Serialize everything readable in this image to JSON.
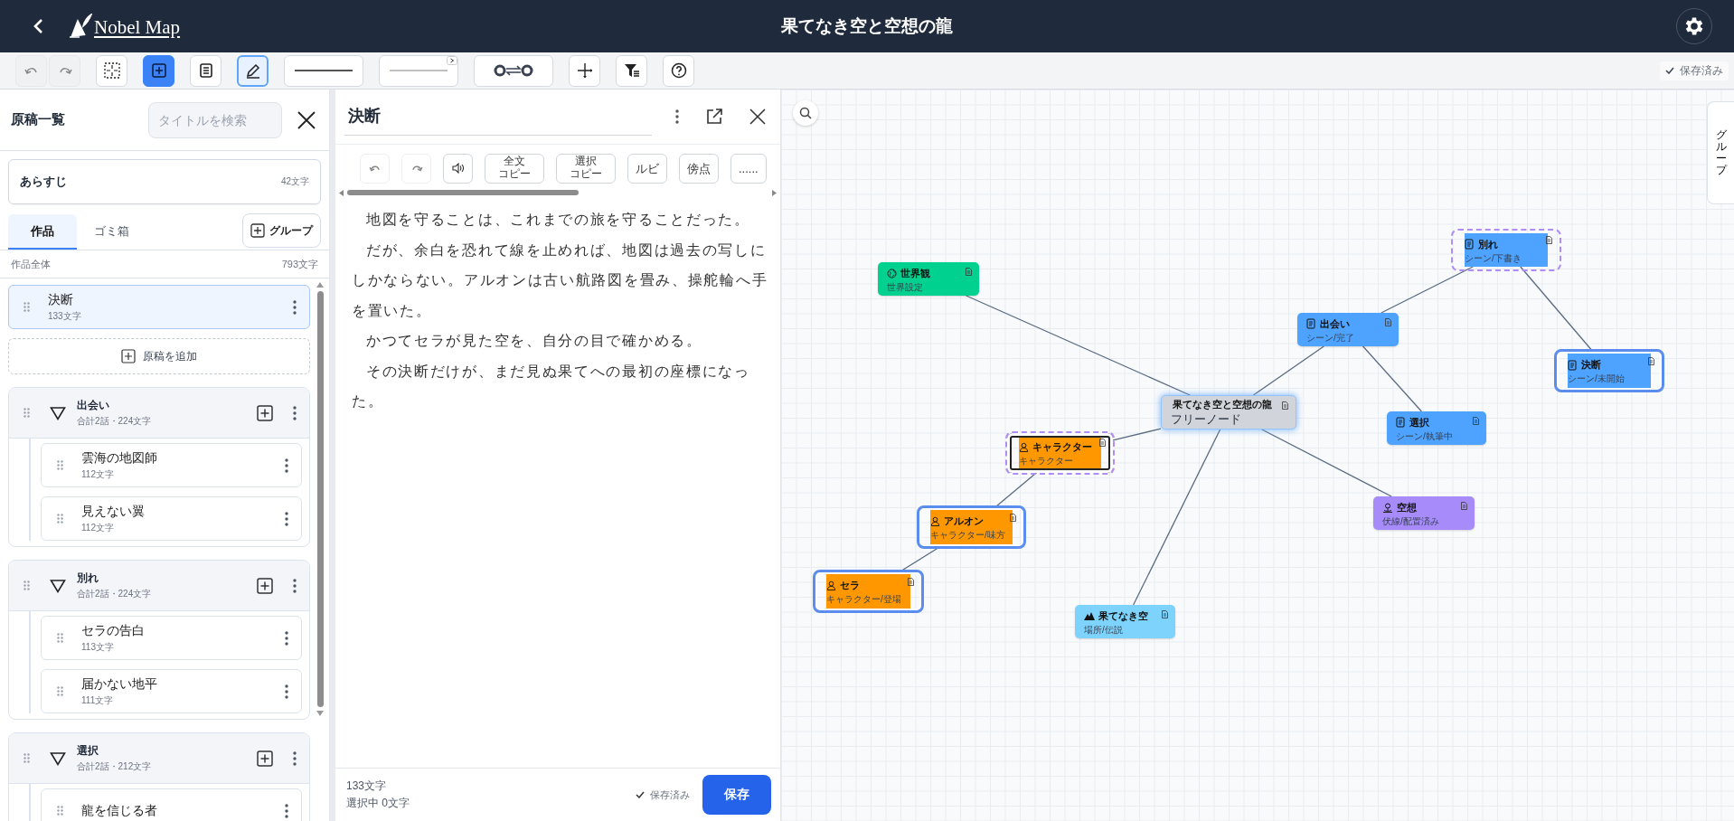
{
  "header": {
    "logo": "Nobel Map",
    "title": "果てなき空と空想の龍"
  },
  "toolbar": {
    "tools": [
      {
        "kind": "undo",
        "disabled": true,
        "selected": false,
        "active": false
      },
      {
        "kind": "redo",
        "disabled": true,
        "selected": false,
        "active": false
      },
      {
        "kind": "fit",
        "disabled": false,
        "selected": false,
        "active": false
      },
      {
        "kind": "add-node",
        "disabled": false,
        "selected": true,
        "active": false
      },
      {
        "kind": "note",
        "disabled": false,
        "selected": false,
        "active": false
      },
      {
        "kind": "pencil",
        "disabled": false,
        "selected": false,
        "active": true
      },
      {
        "kind": "line-solid",
        "disabled": false,
        "selected": false,
        "active": false
      },
      {
        "kind": "line-thin",
        "disabled": false,
        "selected": false,
        "active": false
      },
      {
        "kind": "link",
        "disabled": false,
        "selected": false,
        "active": false
      },
      {
        "kind": "move",
        "disabled": false,
        "selected": false,
        "active": false
      },
      {
        "kind": "filter",
        "disabled": false,
        "selected": false,
        "active": false
      },
      {
        "kind": "help",
        "disabled": false,
        "selected": false,
        "active": false
      }
    ],
    "save_status": "保存済み"
  },
  "manuscripts": {
    "title": "原稿一覧",
    "search": {
      "placeholder": "タイトルを検索"
    },
    "synopsis": {
      "label": "あらすじ",
      "count": "42文字"
    },
    "tabs": [
      {
        "label": "作品",
        "selected": true
      },
      {
        "label": "ゴミ箱",
        "selected": false
      }
    ],
    "group_button": "グループ",
    "summary": {
      "label": "作品全体",
      "count": "793文字"
    },
    "items": [
      {
        "kind": "doc",
        "title": "決断",
        "count": "133文字",
        "selected": true
      },
      {
        "kind": "add",
        "label": "原稿を追加"
      },
      {
        "kind": "group",
        "title": "出会い",
        "count": "合計2話・224文字",
        "expanded": true,
        "children": [
          {
            "title": "雲海の地図師",
            "count": "112文字",
            "selected": false
          },
          {
            "title": "見えない翼",
            "count": "112文字",
            "selected": false
          }
        ]
      },
      {
        "kind": "group",
        "title": "別れ",
        "count": "合計2話・224文字",
        "expanded": true,
        "children": [
          {
            "title": "セラの告白",
            "count": "113文字",
            "selected": false
          },
          {
            "title": "届かない地平",
            "count": "111文字",
            "selected": false
          }
        ]
      },
      {
        "kind": "group",
        "title": "選択",
        "count": "合計2話・212文字",
        "expanded": true,
        "children": [
          {
            "title": "龍を信じる者",
            "selected": false
          }
        ]
      }
    ]
  },
  "editor": {
    "title": "決断",
    "tools": [
      {
        "kind": "undo"
      },
      {
        "kind": "redo"
      },
      {
        "kind": "speaker"
      },
      {
        "kind": "stacked",
        "lines": [
          "全文",
          "コピー"
        ]
      },
      {
        "kind": "stacked",
        "lines": [
          "選択",
          "コピー"
        ]
      },
      {
        "kind": "text",
        "label": "ルビ"
      },
      {
        "kind": "text",
        "label": "傍点"
      },
      {
        "kind": "text",
        "label": "......"
      }
    ],
    "paragraphs": [
      "地図を守ることは、これまでの旅を守ることだった。",
      "だが、余白を恐れて線を止めれば、地図は過去の写しにしかならない。アルオンは古い航路図を畳み、操舵輪へ手を置いた。",
      "かつてセラが見た空を、自分の目で確かめる。",
      "その決断だけが、まだ見ぬ果てへの最初の座標になった。"
    ],
    "char_count": "133文字",
    "selection_count": "選択中 0文字",
    "save_status": "保存済み",
    "save_button": "保存"
  },
  "map": {
    "group_tab": "グループ",
    "root": {
      "title": "果てなき空と空想の龍",
      "subtitle": "フリーノード",
      "kind": "free",
      "color": "#d1d5db",
      "selected": false,
      "highlighted": false,
      "children": [
        {
          "title": "世界観",
          "subtitle": "世界設定",
          "kind": "world",
          "color": "#00d18f",
          "selected": false,
          "highlighted": false
        },
        {
          "title": "出会い",
          "subtitle": "シーン/完了",
          "kind": "scene",
          "color": "#4da3ff",
          "selected": false,
          "highlighted": false,
          "children": [
            {
              "title": "別れ",
              "subtitle": "シーン/下書き",
              "kind": "scene",
              "color": "#4da3ff",
              "selected": false,
              "highlighted": true,
              "children": [
                {
                  "title": "決断",
                  "subtitle": "シーン/未開始",
                  "kind": "scene",
                  "color": "#4da3ff",
                  "selected": true,
                  "highlighted": false
                }
              ]
            },
            {
              "title": "選択",
              "subtitle": "シーン/執筆中",
              "kind": "scene",
              "color": "#4da3ff",
              "selected": false,
              "highlighted": false
            }
          ]
        },
        {
          "title": "キャラクター",
          "subtitle": "キャラクター",
          "kind": "character",
          "color": "#ff9800",
          "selected": false,
          "highlighted": true,
          "children": [
            {
              "title": "アルオン",
              "subtitle": "キャラクター/味方",
              "kind": "character",
              "color": "#ff9800",
              "selected": true,
              "highlighted": false,
              "children": [
                {
                  "title": "セラ",
                  "subtitle": "キャラクター/登場",
                  "kind": "character",
                  "color": "#ff9800",
                  "selected": true,
                  "highlighted": false
                }
              ]
            }
          ]
        },
        {
          "title": "空想",
          "subtitle": "伏線/配置済み",
          "kind": "foreshadow",
          "color": "#a78bfa",
          "selected": false,
          "highlighted": false
        },
        {
          "title": "果てなき空",
          "subtitle": "場所/伝説",
          "kind": "place",
          "color": "#7dd3fc",
          "selected": false,
          "highlighted": false
        }
      ]
    }
  }
}
